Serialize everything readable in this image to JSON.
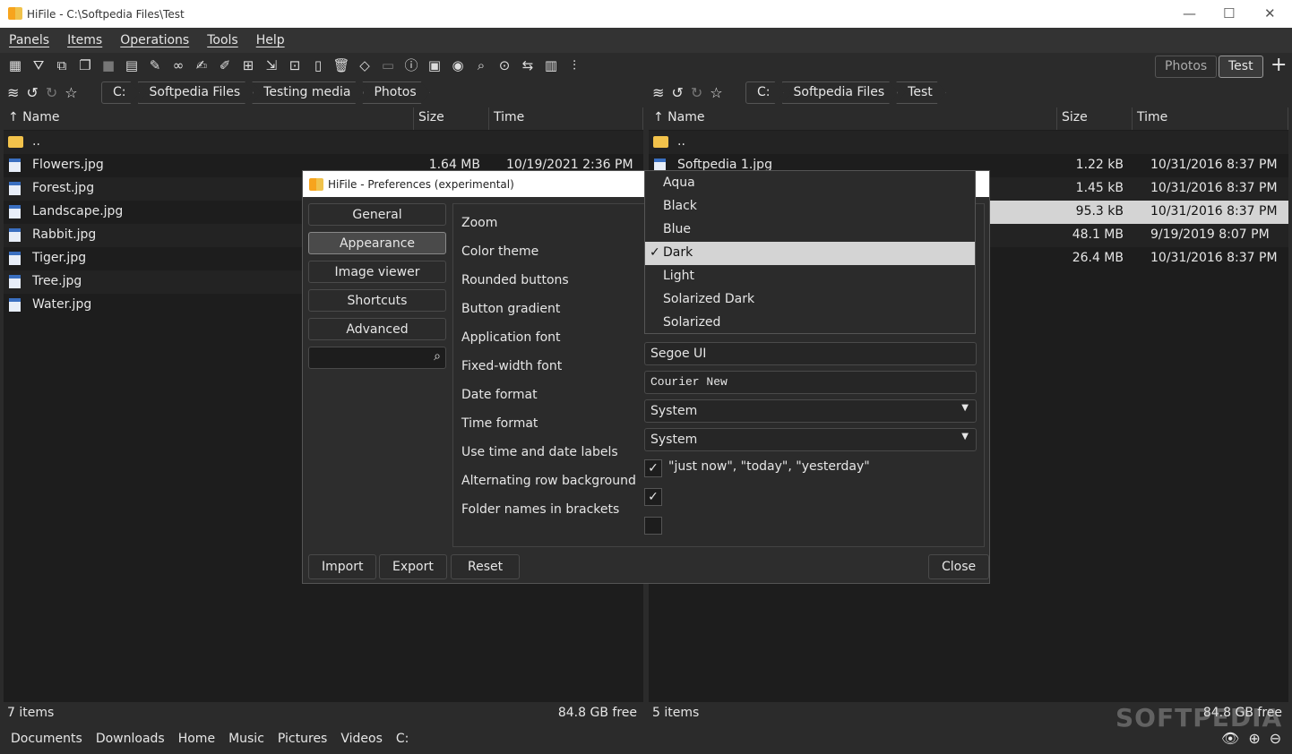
{
  "window": {
    "title": "HiFile - C:\\Softpedia Files\\Test",
    "minimize": "—",
    "maximize": "☐",
    "close": "✕"
  },
  "menu": [
    "Panels",
    "Items",
    "Operations",
    "Tools",
    "Help"
  ],
  "toolbar_icons": [
    "grid-icon",
    "filter-icon",
    "select-icon",
    "copy-icon",
    "move-icon",
    "list-icon",
    "pencil-icon",
    "glasses-icon",
    "edit-icon",
    "edit-select-icon",
    "new-file-icon",
    "shortcut-icon",
    "new-folder-icon",
    "archive-icon",
    "delete-icon",
    "eraser-icon",
    "folder-icon",
    "info-icon",
    "terminal-icon",
    "brain-icon",
    "search-icon",
    "search-content-icon",
    "swap-icon",
    "calendar-icon",
    "sliders-icon"
  ],
  "tabs": [
    {
      "label": "Photos"
    },
    {
      "label": "Test"
    }
  ],
  "add_tab": "+",
  "left": {
    "crumbs": [
      "C:",
      "Softpedia Files",
      "Testing media",
      "Photos"
    ],
    "columns": [
      "↑ Name",
      "Size",
      "Time"
    ],
    "rows": [
      {
        "name": "..",
        "type": "folder",
        "size": "",
        "time": ""
      },
      {
        "name": "Flowers.jpg",
        "size": "1.64 MB",
        "time": "10/19/2021 2:36 PM"
      },
      {
        "name": "Forest.jpg"
      },
      {
        "name": "Landscape.jpg"
      },
      {
        "name": "Rabbit.jpg"
      },
      {
        "name": "Tiger.jpg"
      },
      {
        "name": "Tree.jpg"
      },
      {
        "name": "Water.jpg"
      }
    ],
    "status": "7 items",
    "free": "84.8 GB free"
  },
  "right": {
    "crumbs": [
      "C:",
      "Softpedia Files",
      "Test"
    ],
    "columns": [
      "↑ Name",
      "Size",
      "Time"
    ],
    "rows": [
      {
        "name": "..",
        "type": "folder"
      },
      {
        "name": "Softpedia 1.jpg",
        "size": "1.22 kB",
        "time": "10/31/2016 8:37 PM"
      },
      {
        "name": "",
        "size": "1.45 kB",
        "time": "10/31/2016 8:37 PM"
      },
      {
        "name": "",
        "size": "95.3 kB",
        "time": "10/31/2016 8:37 PM",
        "selected": true
      },
      {
        "name": "",
        "size": "48.1 MB",
        "time": "9/19/2019 8:07 PM"
      },
      {
        "name": "",
        "size": "26.4 MB",
        "time": "10/31/2016 8:37 PM"
      }
    ],
    "status": "5 items",
    "free": "84.8 GB free"
  },
  "bookmarks": [
    "Documents",
    "Downloads",
    "Home",
    "Music",
    "Pictures",
    "Videos",
    "C:"
  ],
  "dialog": {
    "title": "HiFile - Preferences (experimental)",
    "nav": [
      "General",
      "Appearance",
      "Image viewer",
      "Shortcuts",
      "Advanced"
    ],
    "active": "Appearance",
    "labels": [
      "Zoom",
      "Color theme",
      "Rounded buttons",
      "Button gradient",
      "Application font",
      "Fixed-width font",
      "Date format",
      "Time format",
      "Use time and date labels",
      "Alternating row background",
      "Folder names in brackets"
    ],
    "app_font": "Segoe UI",
    "fixed_font": "Courier New",
    "date_format": "System",
    "time_format": "System",
    "time_labels_text": "\"just now\", \"today\", \"yesterday\"",
    "checks": {
      "time_labels": true,
      "alt_row": true,
      "brackets": false
    },
    "buttons": {
      "import": "Import",
      "export": "Export",
      "reset": "Reset",
      "close": "Close"
    },
    "theme_options": [
      "Aqua",
      "Black",
      "Blue",
      "Dark",
      "Light",
      "Solarized Dark",
      "Solarized"
    ],
    "theme_selected": "Dark",
    "check": "✓"
  },
  "watermark": "SOFTPEDIA"
}
